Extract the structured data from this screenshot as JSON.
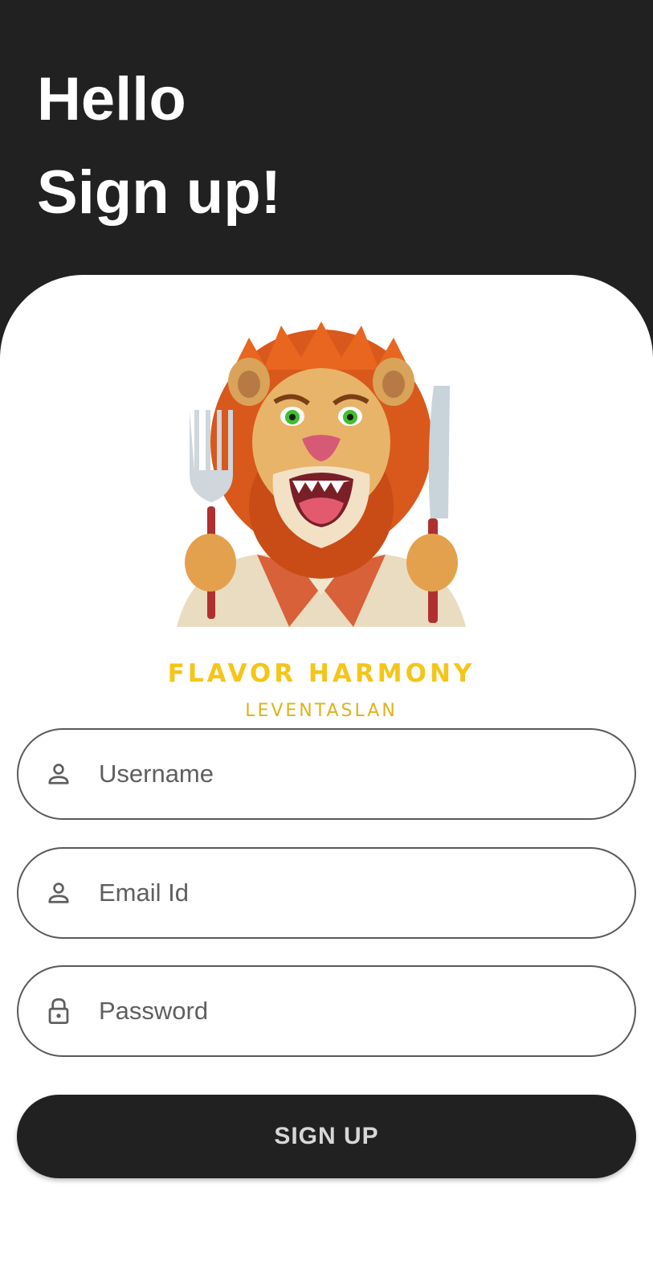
{
  "header": {
    "line1": "Hello",
    "line2": "Sign up!"
  },
  "brand": {
    "name": "FLAVOR HARMONY",
    "subtitle": "LEVENTASLAN",
    "logo_icon": "lion-chef-mascot"
  },
  "form": {
    "username": {
      "placeholder": "Username",
      "value": "",
      "icon": "person-icon"
    },
    "email": {
      "placeholder": "Email Id",
      "value": "",
      "icon": "person-icon"
    },
    "password": {
      "placeholder": "Password",
      "value": "",
      "icon": "lock-icon"
    }
  },
  "actions": {
    "signup_label": "SIGN UP"
  },
  "colors": {
    "header_bg": "#212121",
    "button_bg": "#212121",
    "brand_yellow": "#f5c518",
    "field_border": "#5a5a5a"
  }
}
